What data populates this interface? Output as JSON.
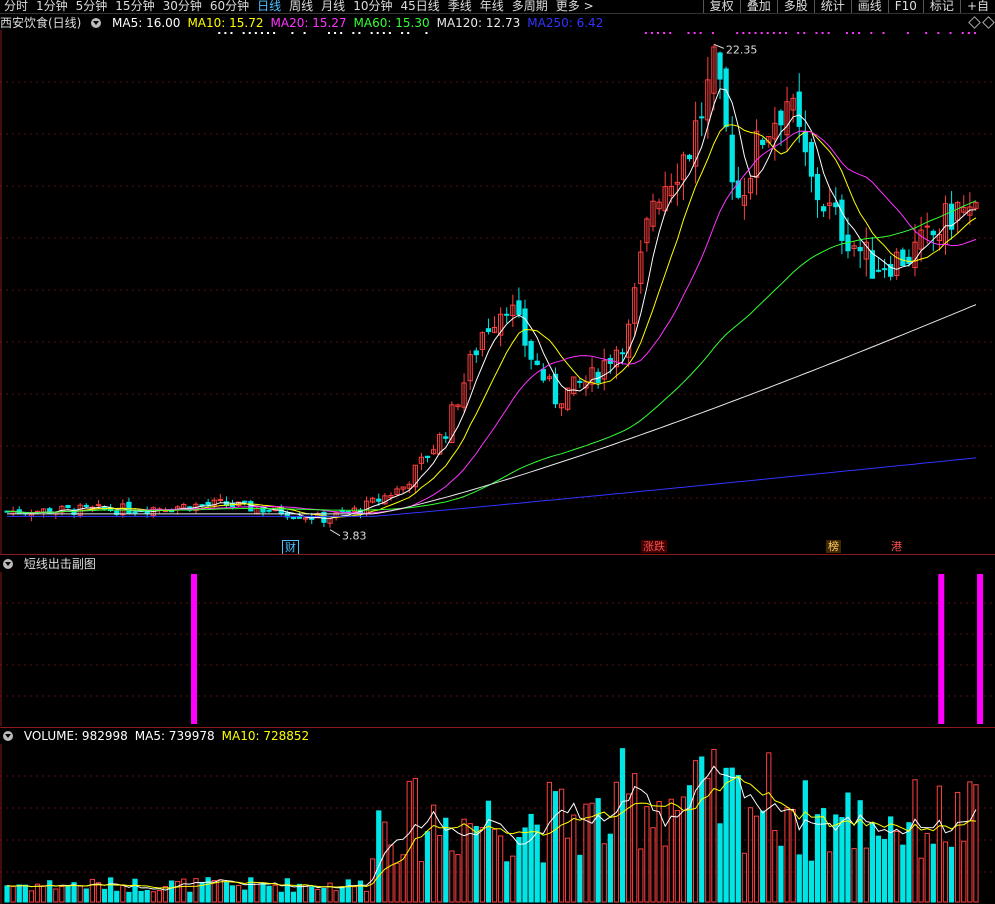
{
  "toolbar": {
    "periods": [
      "分时",
      "1分钟",
      "5分钟",
      "15分钟",
      "30分钟",
      "60分钟",
      "日线",
      "周线",
      "月线",
      "10分钟",
      "45日线",
      "季线",
      "年线",
      "多周期",
      "更多 >"
    ],
    "active_index": 6,
    "right_tools": [
      "复权",
      "叠加",
      "多股",
      "统计",
      "画线",
      "F10",
      "标记",
      "+自"
    ]
  },
  "main_panel": {
    "title": "西安饮食(日线)",
    "ma": [
      {
        "label": "MA5: 16.00",
        "color": "#ffffff"
      },
      {
        "label": "MA10: 15.72",
        "color": "#ffff00"
      },
      {
        "label": "MA20: 15.27",
        "color": "#ff33ff"
      },
      {
        "label": "MA60: 15.30",
        "color": "#33ff33"
      },
      {
        "label": "MA120: 12.73",
        "color": "#e8e8e8"
      },
      {
        "label": "MA250: 6.42",
        "color": "#3333ff"
      }
    ],
    "high_label": "22.35",
    "low_label": "3.83",
    "markers": [
      "财",
      "涨跌",
      "榜",
      "港"
    ]
  },
  "sub_panel": {
    "title": "短线出击副图",
    "signals": [
      0.195,
      0.946,
      0.985
    ]
  },
  "volume_panel": {
    "labels": [
      {
        "label": "VOLUME: 982998",
        "color": "#ffffff"
      },
      {
        "label": "MA5: 739978",
        "color": "#ffffff"
      },
      {
        "label": "MA10: 728852",
        "color": "#ffff00"
      }
    ]
  },
  "colors": {
    "up": "#ff4040",
    "down": "#00e5e5",
    "ma5": "#ffffff",
    "ma10": "#ffff00",
    "ma20": "#ff33ff",
    "ma60": "#33ff33",
    "ma120": "#e8e8e8",
    "ma250": "#3333ff",
    "signal": "#ff00ff"
  }
}
